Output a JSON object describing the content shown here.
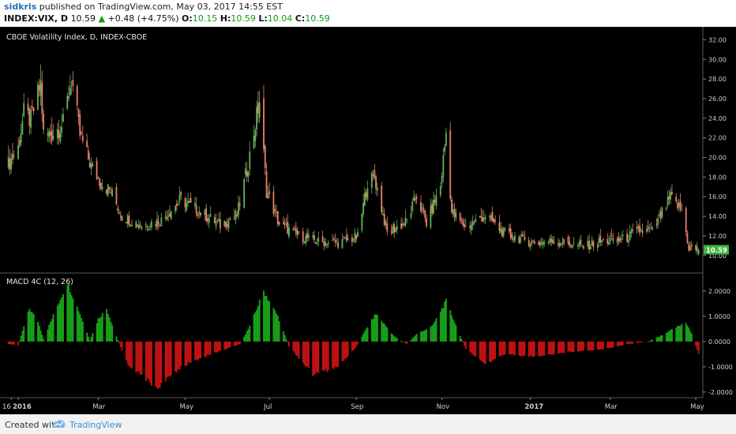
{
  "header": {
    "user": "sidkris",
    "published": "published on TradingView.com, May 03, 2017 14:55 EST",
    "symbol": "INDEX:VIX, D",
    "last": "10.59",
    "change_arrow": "▲",
    "change": "+0.48 (+4.75%)",
    "o_label": "O:",
    "o_value": "10.15",
    "h_label": "H:",
    "h_value": "10.59",
    "l_label": "L:",
    "l_value": "10.04",
    "c_label": "C:",
    "c_value": "10.59"
  },
  "footer": {
    "created_with": "Created with",
    "brand": "TradingView"
  },
  "colors": {
    "up": "#62b35a",
    "down": "#e9826a",
    "hist_up": "#18a118",
    "hist_down": "#c01212",
    "background": "#000000",
    "accent": "#2a6fb3",
    "price_badge": "#3cb440"
  },
  "chart_data": [
    {
      "type": "candlestick",
      "title": "CBOE Volatility Index, D, INDEX-CBOE",
      "ylim": [
        9.5,
        33
      ],
      "y_ticks": [
        "32.00",
        "30.00",
        "28.00",
        "26.00",
        "24.00",
        "22.00",
        "20.00",
        "18.00",
        "16.00",
        "14.00",
        "12.00",
        "10.00"
      ],
      "last_price_label": "10.59",
      "x_labels": [
        "16",
        "2016",
        "Mar",
        "May",
        "Jul",
        "Sep",
        "Nov",
        "2017",
        "Mar",
        "May"
      ],
      "close_path": [
        [
          "2015-12-28",
          19.3
        ],
        [
          "2016-01-04",
          21.0
        ],
        [
          "2016-01-08",
          24.5
        ],
        [
          "2016-01-13",
          23.8
        ],
        [
          "2016-01-20",
          27.5
        ],
        [
          "2016-01-22",
          22.3
        ],
        [
          "2016-01-28",
          22.4
        ],
        [
          "2016-02-05",
          23.4
        ],
        [
          "2016-02-11",
          28.1
        ],
        [
          "2016-02-17",
          22.3
        ],
        [
          "2016-02-25",
          19.1
        ],
        [
          "2016-03-03",
          17.4
        ],
        [
          "2016-03-10",
          16.5
        ],
        [
          "2016-03-18",
          14.0
        ],
        [
          "2016-04-01",
          13.1
        ],
        [
          "2016-04-15",
          13.6
        ],
        [
          "2016-04-29",
          15.7
        ],
        [
          "2016-05-13",
          14.4
        ],
        [
          "2016-05-27",
          13.1
        ],
        [
          "2016-06-08",
          14.1
        ],
        [
          "2016-06-16",
          19.4
        ],
        [
          "2016-06-24",
          25.8
        ],
        [
          "2016-06-29",
          16.6
        ],
        [
          "2016-07-08",
          13.2
        ],
        [
          "2016-07-22",
          12.0
        ],
        [
          "2016-08-05",
          11.4
        ],
        [
          "2016-08-19",
          11.3
        ],
        [
          "2016-09-02",
          11.9
        ],
        [
          "2016-09-09",
          17.5
        ],
        [
          "2016-09-14",
          18.0
        ],
        [
          "2016-09-23",
          12.3
        ],
        [
          "2016-10-07",
          13.5
        ],
        [
          "2016-10-14",
          16.1
        ],
        [
          "2016-10-21",
          13.3
        ],
        [
          "2016-10-31",
          17.1
        ],
        [
          "2016-11-04",
          22.5
        ],
        [
          "2016-11-08",
          14.4
        ],
        [
          "2016-11-18",
          12.9
        ],
        [
          "2016-12-02",
          14.1
        ],
        [
          "2016-12-16",
          12.2
        ],
        [
          "2017-01-06",
          11.3
        ],
        [
          "2017-01-20",
          11.5
        ],
        [
          "2017-02-10",
          10.9
        ],
        [
          "2017-02-24",
          11.5
        ],
        [
          "2017-03-10",
          11.6
        ],
        [
          "2017-03-21",
          12.5
        ],
        [
          "2017-03-31",
          12.4
        ],
        [
          "2017-04-13",
          15.9
        ],
        [
          "2017-04-21",
          14.6
        ],
        [
          "2017-04-26",
          10.8
        ],
        [
          "2017-05-03",
          10.59
        ]
      ]
    },
    {
      "type": "histogram",
      "title": "MACD 4C (12, 26)",
      "ylim": [
        -2.1,
        2.4
      ],
      "y_ticks": [
        "2.0000",
        "1.0000",
        "0.0000",
        "-1.0000",
        "-2.0000"
      ],
      "series_path": [
        [
          "2015-12-28",
          -0.1
        ],
        [
          "2016-01-04",
          -0.15
        ],
        [
          "2016-01-08",
          0.6
        ],
        [
          "2016-01-12",
          1.3
        ],
        [
          "2016-01-18",
          0.8
        ],
        [
          "2016-01-22",
          0.1
        ],
        [
          "2016-01-28",
          0.9
        ],
        [
          "2016-02-08",
          2.35
        ],
        [
          "2016-02-17",
          1.1
        ],
        [
          "2016-02-24",
          0.05
        ],
        [
          "2016-03-01",
          0.9
        ],
        [
          "2016-03-07",
          1.3
        ],
        [
          "2016-03-14",
          0.2
        ],
        [
          "2016-03-22",
          -0.9
        ],
        [
          "2016-04-12",
          -1.85
        ],
        [
          "2016-04-29",
          -1.0
        ],
        [
          "2016-05-20",
          -0.5
        ],
        [
          "2016-06-10",
          -0.1
        ],
        [
          "2016-06-17",
          0.6
        ],
        [
          "2016-06-27",
          2.0
        ],
        [
          "2016-07-07",
          1.0
        ],
        [
          "2016-07-15",
          -0.2
        ],
        [
          "2016-08-01",
          -1.3
        ],
        [
          "2016-08-19",
          -1.0
        ],
        [
          "2016-09-01",
          -0.2
        ],
        [
          "2016-09-08",
          0.5
        ],
        [
          "2016-09-15",
          1.1
        ],
        [
          "2016-09-28",
          0.2
        ],
        [
          "2016-10-07",
          -0.1
        ],
        [
          "2016-10-14",
          0.3
        ],
        [
          "2016-10-25",
          0.6
        ],
        [
          "2016-11-04",
          1.6
        ],
        [
          "2016-11-12",
          0.5
        ],
        [
          "2016-11-18",
          -0.3
        ],
        [
          "2016-12-02",
          -0.9
        ],
        [
          "2016-12-16",
          -0.5
        ],
        [
          "2017-01-06",
          -0.6
        ],
        [
          "2017-02-01",
          -0.4
        ],
        [
          "2017-02-24",
          -0.3
        ],
        [
          "2017-03-14",
          -0.1
        ],
        [
          "2017-03-28",
          0.0
        ],
        [
          "2017-04-05",
          0.2
        ],
        [
          "2017-04-15",
          0.5
        ],
        [
          "2017-04-24",
          0.75
        ],
        [
          "2017-04-28",
          0.3
        ],
        [
          "2017-05-03",
          -0.5
        ]
      ]
    }
  ]
}
